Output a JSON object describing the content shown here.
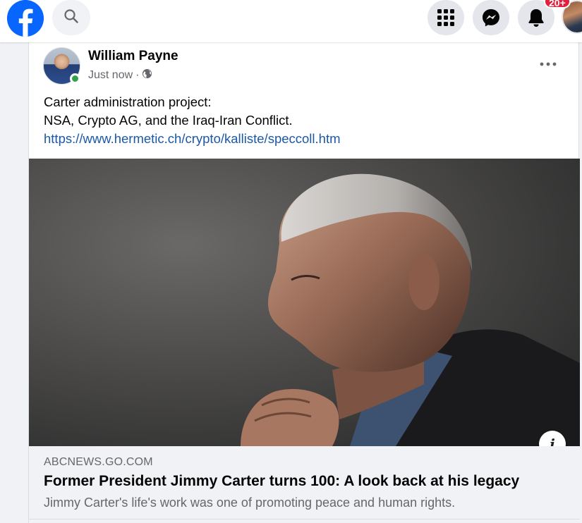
{
  "header": {
    "notifications_badge": "20+",
    "colors": {
      "brand": "#0866ff",
      "badge": "#e41e3f",
      "button_bg": "#e4e6eb"
    },
    "icons": [
      "facebook-logo-icon",
      "search-icon",
      "menu-grid-icon",
      "messenger-icon",
      "bell-icon"
    ]
  },
  "post": {
    "author": "William Payne",
    "time": "Just now",
    "separator": "·",
    "privacy_icon": "globe-icon",
    "text_lines": [
      "Carter administration project:",
      "NSA, Crypto AG, and the Iraq-Iran Conflict."
    ],
    "link": "https://www.hermetic.ch/crypto/kalliste/speccoll.htm",
    "more_icon": "more-options-icon"
  },
  "link_preview": {
    "domain": "ABCNEWS.GO.COM",
    "headline": "Former President Jimmy Carter turns 100: A look back at his legacy",
    "summary": "Jimmy Carter's life's work was one of promoting peace and human rights.",
    "info_icon": "i"
  }
}
